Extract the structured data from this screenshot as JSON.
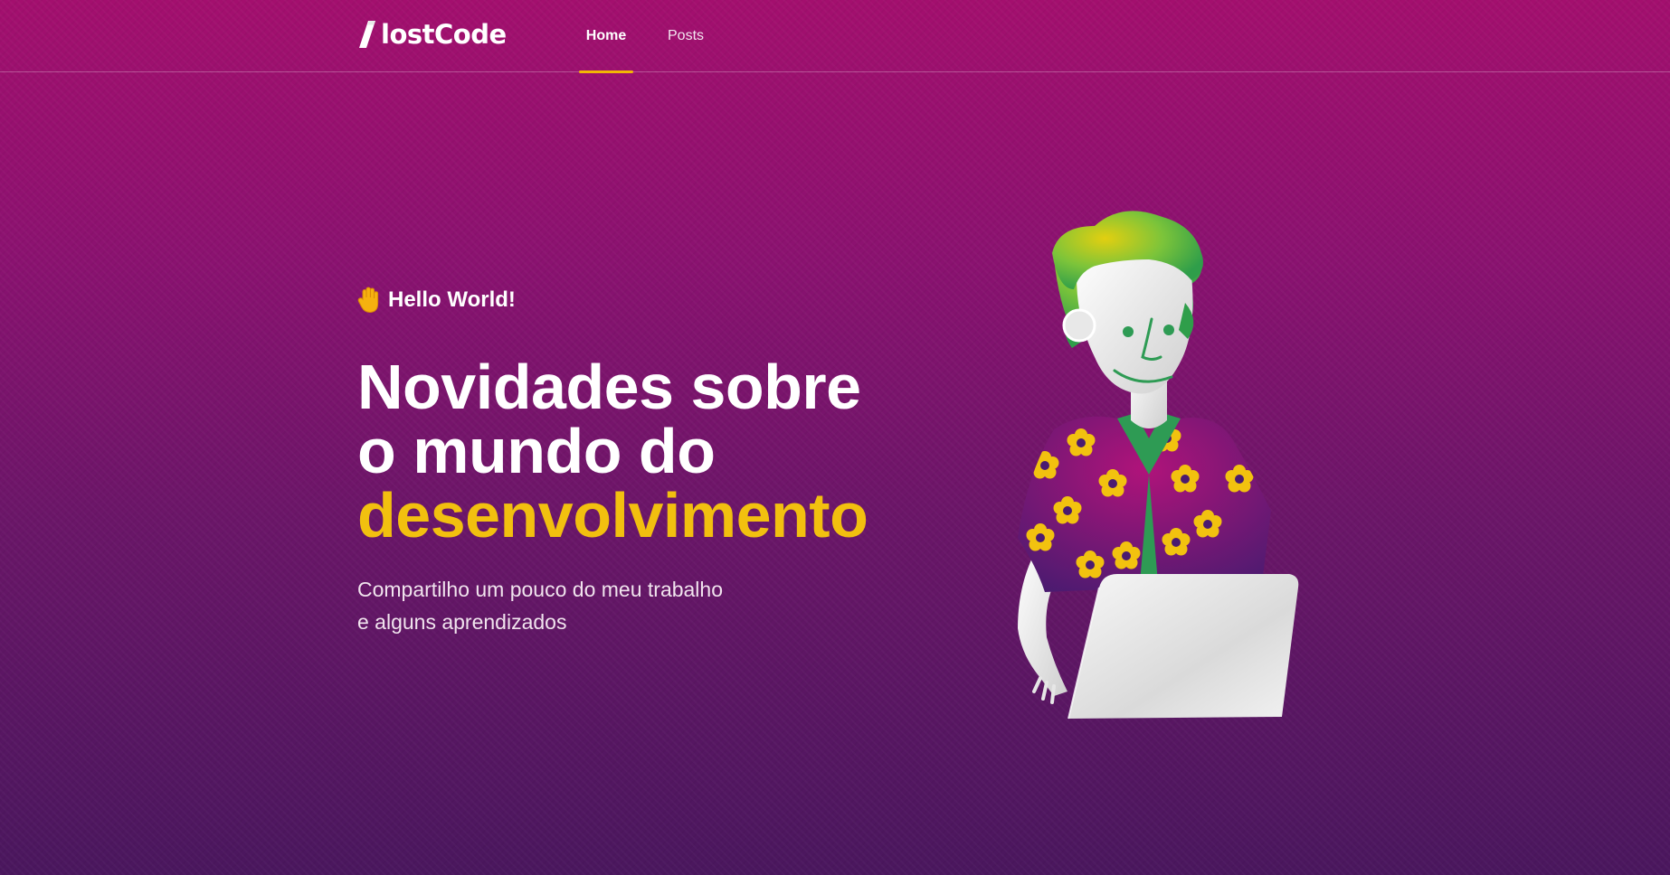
{
  "brand": {
    "name": "lostCode",
    "accent_color": "#f2b705"
  },
  "nav": {
    "items": [
      {
        "label": "Home",
        "active": true
      },
      {
        "label": "Posts",
        "active": false
      }
    ]
  },
  "hero": {
    "greeting_icon": "waving-hand-icon",
    "greeting": "Hello World!",
    "headline_line1": "Novidades sobre",
    "headline_line2": "o mundo do",
    "headline_accent": "desenvolvimento",
    "subtitle_line1": "Compartilho um pouco do meu trabalho",
    "subtitle_line2": "e alguns aprendizados",
    "illustration": "developer-with-laptop-illustration"
  }
}
